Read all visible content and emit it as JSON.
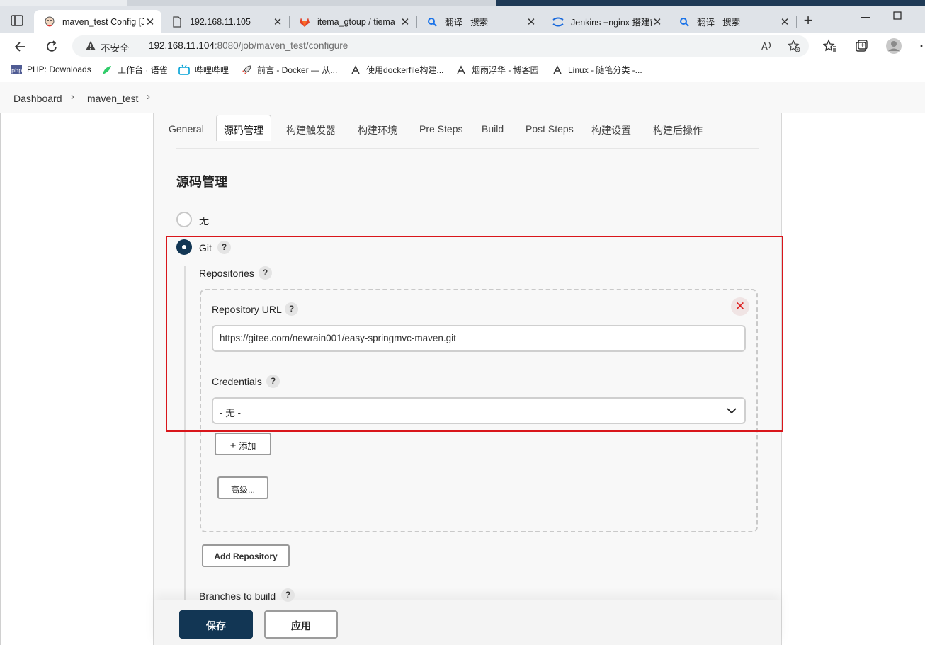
{
  "browser": {
    "tabs": [
      {
        "title": "maven_test Config [Je",
        "active": true
      },
      {
        "title": "192.168.11.105",
        "active": false
      },
      {
        "title": "itema_gtoup / tiema",
        "active": false
      },
      {
        "title": "翻译 - 搜索",
        "active": false
      },
      {
        "title": "Jenkins +nginx 搭建前",
        "active": false
      },
      {
        "title": "翻译 - 搜索",
        "active": false
      }
    ],
    "security_label": "不安全",
    "url_host": "192.168.11.104",
    "url_rest": ":8080/job/maven_test/configure",
    "bookmarks": [
      {
        "label": "PHP: Downloads"
      },
      {
        "label": "工作台 · 语雀"
      },
      {
        "label": "哔哩哔哩"
      },
      {
        "label": "前言 - Docker — 从..."
      },
      {
        "label": "使用dockerfile构建..."
      },
      {
        "label": "烟雨浮华 - 博客园"
      },
      {
        "label": "Linux - 随笔分类 -..."
      }
    ]
  },
  "breadcrumb": {
    "items": [
      "Dashboard",
      "maven_test"
    ]
  },
  "config_tabs": [
    "General",
    "源码管理",
    "构建触发器",
    "构建环境",
    "Pre Steps",
    "Build",
    "Post Steps",
    "构建设置",
    "构建后操作"
  ],
  "scm": {
    "section_title": "源码管理",
    "option_none": "无",
    "option_git": "Git",
    "selected": "Git",
    "repositories_label": "Repositories",
    "repository_url_label": "Repository URL",
    "repository_url_value": "https://gitee.com/newrain001/easy-springmvc-maven.git",
    "credentials_label": "Credentials",
    "credentials_value": "- 无 -",
    "add_button": "添加",
    "advanced_button": "高级...",
    "add_repository_button": "Add Repository",
    "branches_label": "Branches to build"
  },
  "footer": {
    "save_button": "保存",
    "apply_button": "应用"
  },
  "colors": {
    "primary": "#123654",
    "highlight": "#d9161b",
    "delete": "#dd2222"
  }
}
